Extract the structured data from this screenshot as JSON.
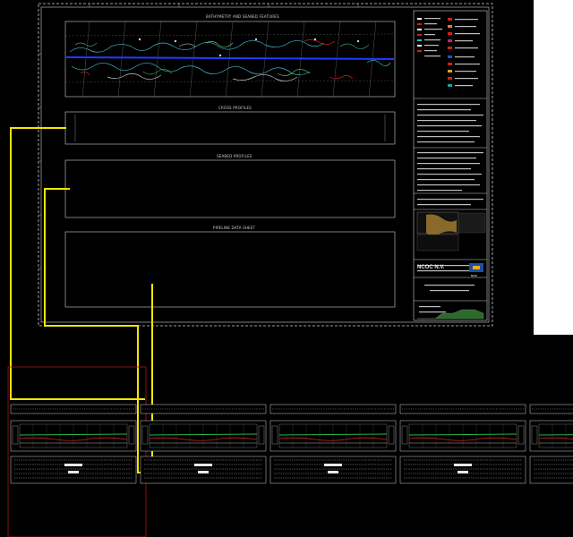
{
  "sheet": {
    "section_titles": {
      "plan": "BATHYMETRY AND SEABED FEATURES",
      "cross": "CROSS PROFILES",
      "seabed": "SEABED PROFILES",
      "pipeline": "PIPELINE DATA SHEET"
    },
    "company_text": "NCOC N.V.",
    "logo_text": "NCOC"
  },
  "colors": {
    "background": "#000000",
    "sheet_border": "#d0d0d0",
    "annotation_yellow": "#f2e600",
    "selection_red": "#b01515",
    "route_blue": "#1e3cff",
    "contour_cyan": "#3fb6c8",
    "profile_green": "#25b54a",
    "profile_red": "#d02020"
  },
  "bottom_strips": {
    "count": 5
  }
}
